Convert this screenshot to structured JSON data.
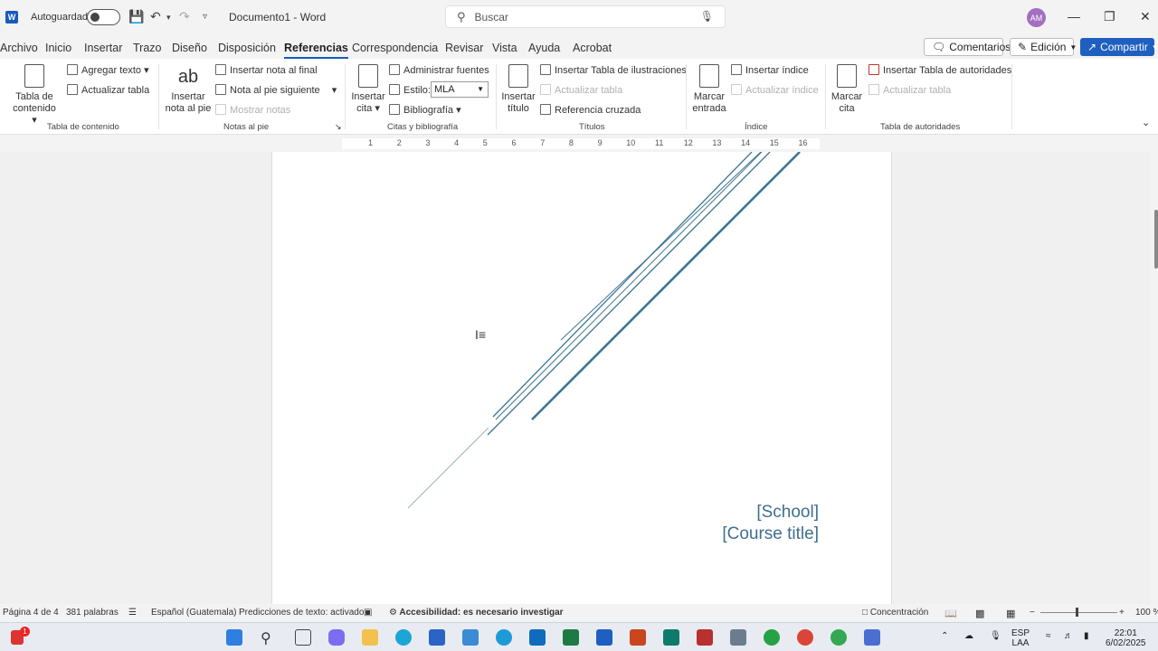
{
  "titlebar": {
    "app_logo": "W",
    "autosave_label": "Autoguardado",
    "doc_title": "Documento1 - Word",
    "search_placeholder": "Buscar",
    "avatar_initials": "AM"
  },
  "menu": {
    "tabs": [
      "Archivo",
      "Inicio",
      "Insertar",
      "Trazo",
      "Diseño",
      "Disposición",
      "Referencias",
      "Correspondencia",
      "Revisar",
      "Vista",
      "Ayuda",
      "Acrobat"
    ],
    "active_tab": "Referencias",
    "comments_label": "Comentarios",
    "edit_label": "Edición",
    "share_label": "Compartir"
  },
  "ribbon": {
    "toc": {
      "big_line1": "Tabla de",
      "big_line2": "contenido",
      "add_text": "Agregar texto",
      "update_table": "Actualizar tabla",
      "group": "Tabla de contenido"
    },
    "footnotes": {
      "big_line1": "Insertar",
      "big_line2": "nota al pie",
      "big_icon_text": "ab",
      "endnote": "Insertar nota al final",
      "next_footnote": "Nota al pie siguiente",
      "show_notes": "Mostrar notas",
      "group": "Notas al pie"
    },
    "citations": {
      "big_line1": "Insertar",
      "big_line2": "cita",
      "manage_sources": "Administrar fuentes",
      "style_label": "Estilo:",
      "style_value": "MLA",
      "bibliography": "Bibliografía",
      "group": "Citas y bibliografía"
    },
    "captions": {
      "big_line1": "Insertar",
      "big_line2": "título",
      "insert_figures": "Insertar Tabla de ilustraciones",
      "update_table": "Actualizar tabla",
      "cross_ref": "Referencia cruzada",
      "group": "Títulos"
    },
    "index": {
      "big_line1": "Marcar",
      "big_line2": "entrada",
      "insert_index": "Insertar índice",
      "update_index": "Actualizar índice",
      "group": "Índice"
    },
    "authorities": {
      "big_line1": "Marcar",
      "big_line2": "cita",
      "insert_table": "Insertar Tabla de autoridades",
      "update_table": "Actualizar tabla",
      "group": "Tabla de autoridades"
    }
  },
  "ruler": {
    "numbers": [
      "1",
      "2",
      "3",
      "4",
      "5",
      "6",
      "7",
      "8",
      "9",
      "10",
      "11",
      "12",
      "13",
      "14",
      "15",
      "16"
    ]
  },
  "document": {
    "school": "[School]",
    "course": "[Course title]"
  },
  "status": {
    "page": "Página 4 de 4",
    "words": "381 palabras",
    "language": "Español (Guatemala)",
    "predictions": "Predicciones de texto: activado",
    "accessibility": "Accesibilidad: es necesario investigar",
    "focus": "Concentración",
    "zoom": "100 %"
  },
  "taskbar": {
    "notif_badge": "1",
    "lang_line1": "ESP",
    "lang_line2": "LAA",
    "time": "22:01",
    "date": "6/02/2025"
  },
  "colors": {
    "accent": "#185abd",
    "share_bg": "#1f5fbf",
    "deco_line": "#3e7594"
  }
}
